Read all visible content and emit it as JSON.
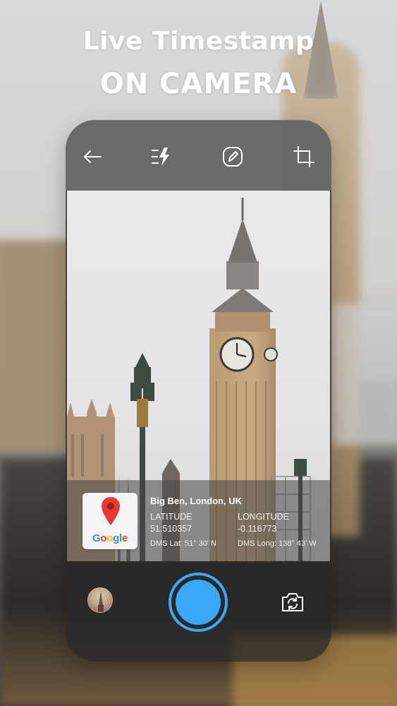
{
  "promo": {
    "headline_line1": "Live Timestamp",
    "headline_line2": "ON CAMERA"
  },
  "toolbar": {
    "back_icon": "arrow-left-icon",
    "flash_icon": "flash-settings-icon",
    "edit_icon": "edit-icon",
    "crop_icon": "crop-icon"
  },
  "timestamp": {
    "location": "Big Ben, London, UK",
    "latitude_label": "LATITUDE",
    "latitude_value": "51.510357",
    "longitude_label": "LONGITUDE",
    "longitude_value": "-0.116773",
    "dms_lat": "DMS Lat: 51° 30' N",
    "dms_long": "DMS Long: 138° 43' W",
    "map_brand": "Google"
  },
  "controls": {
    "gallery_icon": "gallery-thumbnail",
    "shutter_icon": "shutter-button",
    "flip_icon": "flip-camera-icon"
  },
  "colors": {
    "accent": "#3aa8f6",
    "map_pin": "#e53935"
  }
}
